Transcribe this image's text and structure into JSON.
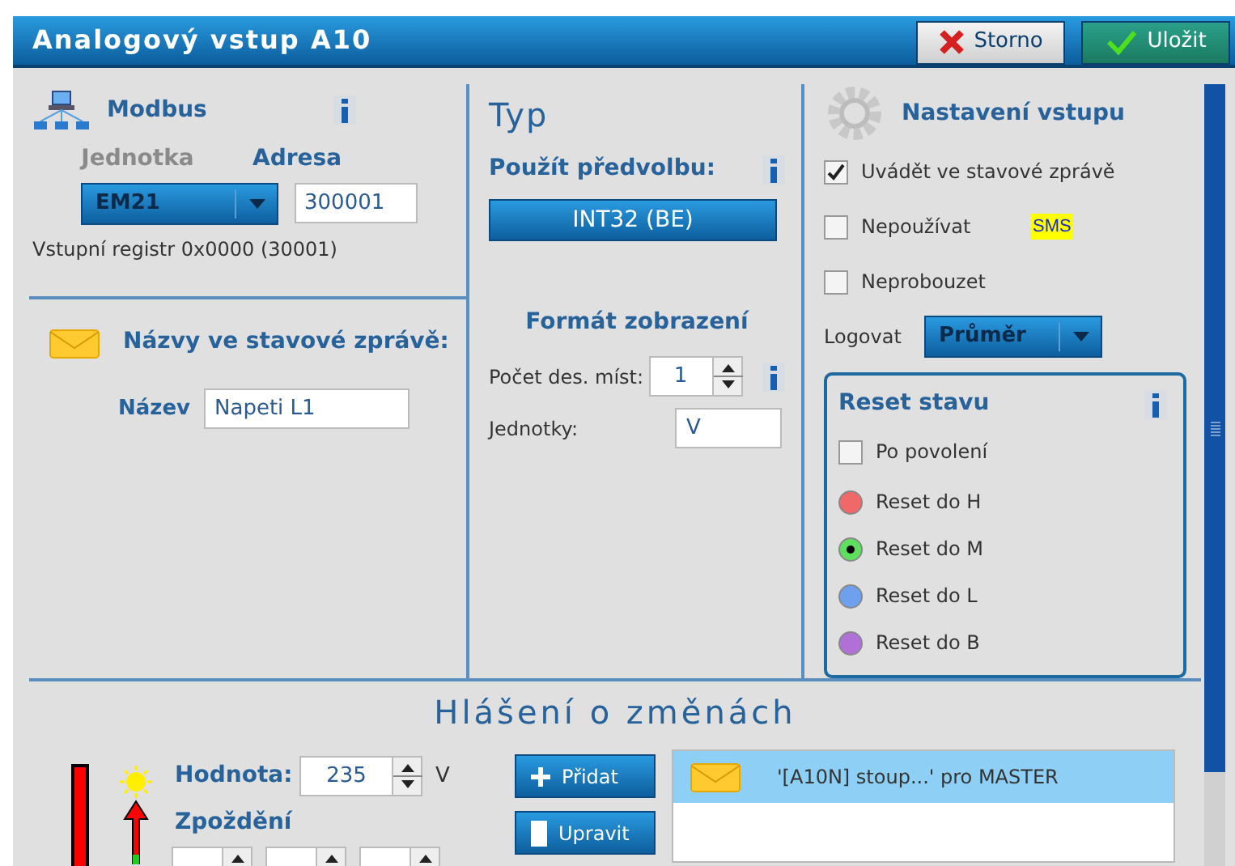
{
  "window": {
    "title": "Analogový vstup A10",
    "buttons": [
      {
        "label": "Storno",
        "kind": "cancel"
      },
      {
        "label": "Uložit",
        "kind": "save"
      }
    ]
  },
  "modbus": {
    "title": "Modbus",
    "unit": {
      "label": "Jednotka",
      "disabled": true,
      "value": "EM21"
    },
    "address": {
      "label": "Adresa",
      "value": "300001"
    },
    "register_note": "Vstupní registr 0x0000 (30001)"
  },
  "names": {
    "title": "Názvy ve stavové zprávě:",
    "name_label": "Název",
    "name_value": "Napeti L1"
  },
  "type": {
    "title": "Typ",
    "preset_label": "Použít předvolbu:",
    "preset_button": "INT32 (BE)",
    "format_title": "Formát zobrazení",
    "decimals_label": "Počet des. míst:",
    "decimals_value": "1",
    "units_label": "Jednotky:",
    "units_value": "V"
  },
  "input_settings": {
    "title": "Nastavení vstupu",
    "checkboxes": [
      {
        "label": "Uvádět ve stavové zprávě",
        "checked": true
      },
      {
        "label": "Nepoužívat",
        "checked": false
      },
      {
        "label": "Neprobouzet",
        "checked": false
      }
    ],
    "sms_badge": "SMS",
    "log_label": "Logovat",
    "log_value": "Průměr"
  },
  "reset": {
    "title": "Reset stavu",
    "after_enable": {
      "label": "Po povolení",
      "checked": false
    },
    "options": [
      {
        "label": "Reset do H",
        "color": "#f06868",
        "selected": false
      },
      {
        "label": "Reset do M",
        "color": "#5ee05e",
        "selected": true
      },
      {
        "label": "Reset do L",
        "color": "#6fa0f0",
        "selected": false
      },
      {
        "label": "Reset do B",
        "color": "#b070d8",
        "selected": false
      }
    ]
  },
  "changes": {
    "title": "Hlášení o změnách",
    "value_label": "Hodnota:",
    "value": "235",
    "unit": "V",
    "delay_label": "Zpoždění",
    "delay_fields": [
      {
        "kind": "spinner"
      },
      {
        "kind": "spinner"
      },
      {
        "kind": "spinner"
      }
    ],
    "buttons": [
      {
        "label": "Přidat",
        "kind": "add"
      },
      {
        "label": "Upravit",
        "kind": "edit"
      }
    ],
    "messages": [
      {
        "text": "'[A10N] stoup...' pro MASTER",
        "selected": true
      }
    ]
  }
}
